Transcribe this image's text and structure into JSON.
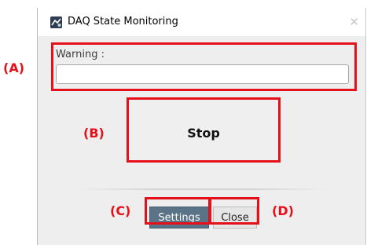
{
  "window": {
    "title": "DAQ State Monitoring",
    "close_glyph": "✕",
    "app_icon": "daq-app-icon"
  },
  "warning": {
    "label": "Warning :",
    "value": "",
    "placeholder": ""
  },
  "buttons": {
    "stop": "Stop",
    "settings": "Settings",
    "close": "Close"
  },
  "annotations": {
    "a": "(A)",
    "b": "(B)",
    "c": "(C)",
    "d": "(D)"
  },
  "colors": {
    "annotation": "#e6101a",
    "settings_button": "#5b7386",
    "window_bg": "#eeeeee"
  }
}
